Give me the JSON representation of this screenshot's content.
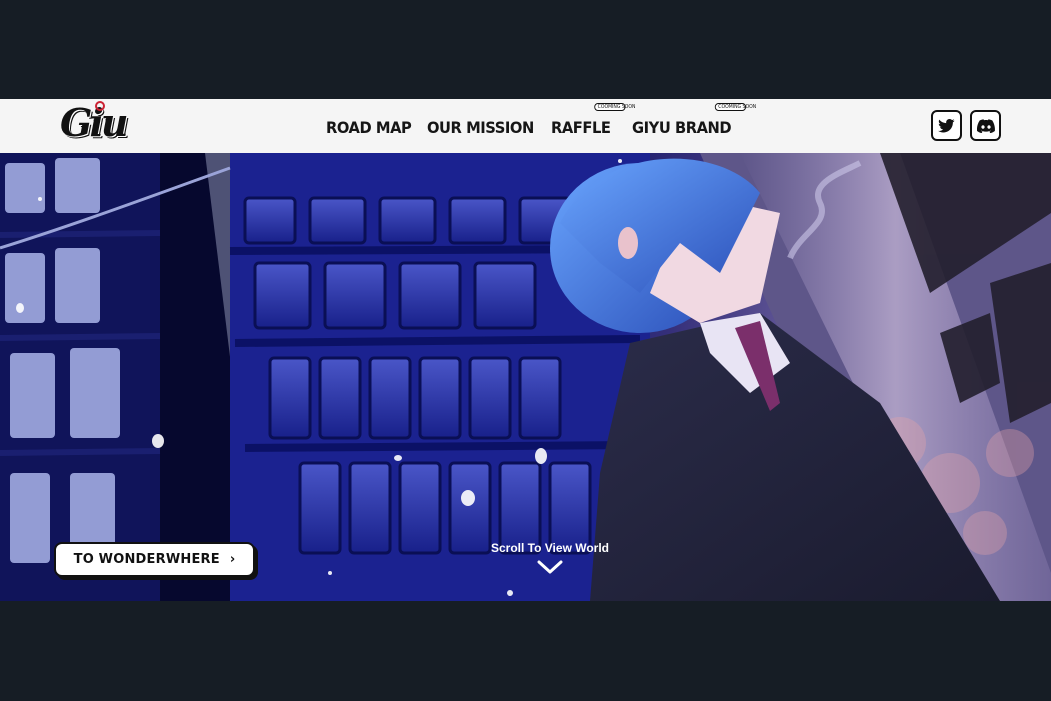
{
  "header": {
    "logo_text": "Giu",
    "nav": [
      {
        "label": "ROAD MAP"
      },
      {
        "label": "OUR MISSION"
      },
      {
        "label": "RAFFLE",
        "badge": "COOMING SOON"
      },
      {
        "label": "GIYU BRAND",
        "badge": "COOMING SOON"
      }
    ],
    "social": [
      {
        "icon": "twitter-icon"
      },
      {
        "icon": "discord-icon"
      }
    ]
  },
  "hero": {
    "cta_label": "TO WONDERWHERE",
    "cta_chevron": "›",
    "scroll_label": "Scroll To View World",
    "scroll_icon": "chevron-down-icon"
  },
  "colors": {
    "page_bg": "#161d25",
    "header_bg": "#f5f5f5",
    "ink": "#111111",
    "hero_blue": "#1e2680"
  }
}
